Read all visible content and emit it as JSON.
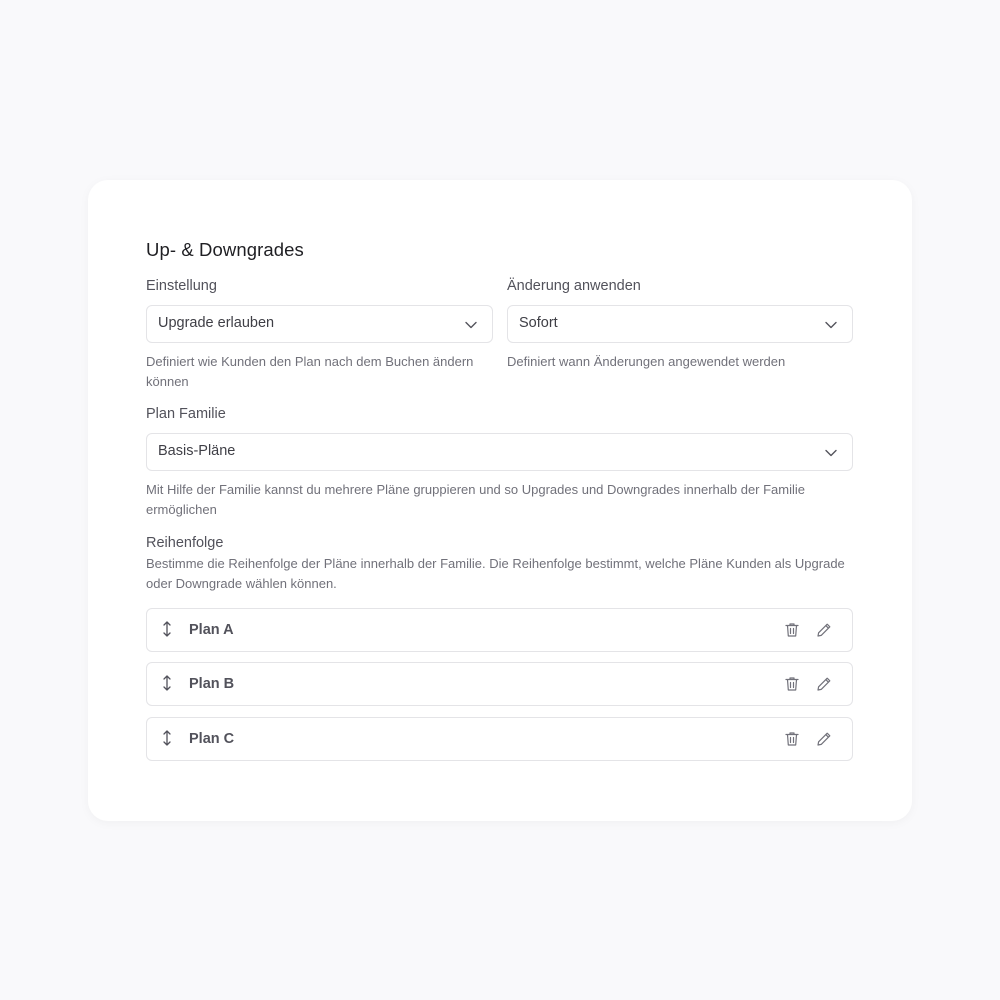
{
  "section": {
    "title": "Up- & Downgrades"
  },
  "setting": {
    "label": "Einstellung",
    "value": "Upgrade erlauben",
    "help": "Definiert wie Kunden den Plan nach dem Buchen ändern können"
  },
  "apply_change": {
    "label": "Änderung anwenden",
    "value": "Sofort",
    "help": "Definiert wann Änderungen angewendet werden"
  },
  "plan_family": {
    "label": "Plan Familie",
    "value": "Basis-Pläne",
    "help": "Mit Hilfe der Familie kannst du mehrere Pläne gruppieren und so Upgrades und Downgrades innerhalb der Familie ermöglichen"
  },
  "order": {
    "label": "Reihenfolge",
    "help": "Bestimme die Reihenfolge der Pläne innerhalb der Familie. Die Reihenfolge bestimmt, welche Pläne Kunden als Upgrade oder Downgrade wählen können.",
    "plans": [
      {
        "name": "Plan A"
      },
      {
        "name": "Plan B"
      },
      {
        "name": "Plan C"
      }
    ]
  },
  "icons": {
    "chevron": "chevron-down-icon",
    "drag": "drag-handle-icon",
    "trash": "trash-icon",
    "edit": "pencil-icon"
  },
  "colors": {
    "background": "#f9f9fb",
    "card": "#ffffff",
    "border": "#e4e4e7",
    "text": "#3f3f46",
    "muted": "#71717a"
  }
}
